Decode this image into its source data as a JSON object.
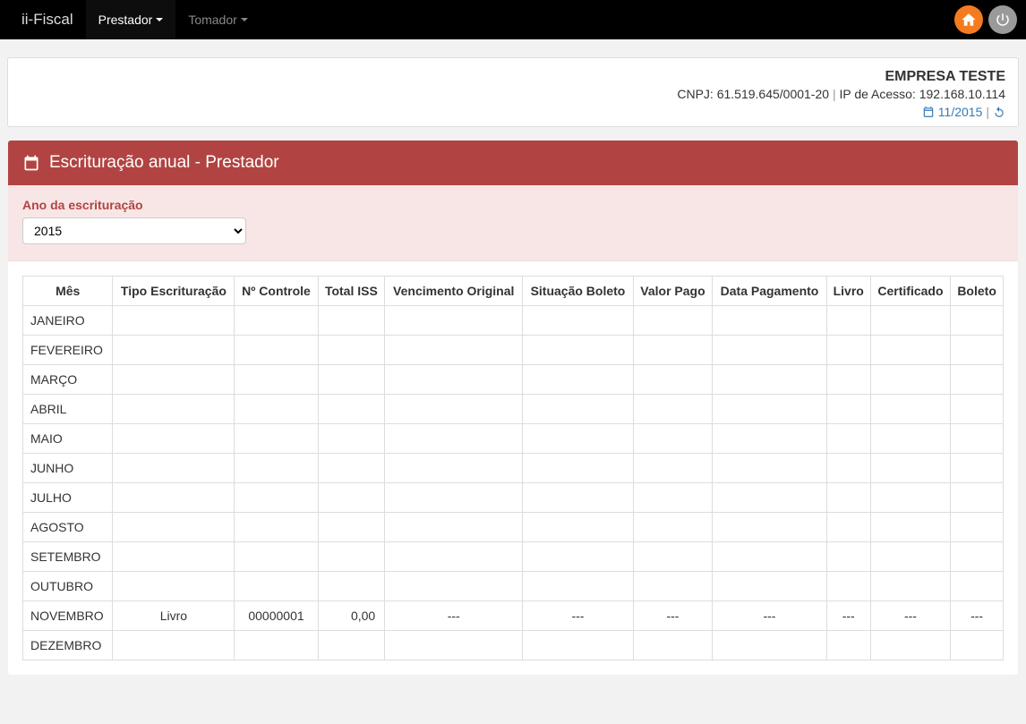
{
  "nav": {
    "brand": "ii-Fiscal",
    "items": [
      {
        "label": "Prestador",
        "active": true
      },
      {
        "label": "Tomador",
        "active": false
      }
    ]
  },
  "company": {
    "name": "EMPRESA TESTE",
    "cnpj_label": "CNPJ:",
    "cnpj": "61.519.645/0001-20",
    "ip_label": "IP de Acesso:",
    "ip": "192.168.10.114",
    "period": "11/2015"
  },
  "panel": {
    "title": "Escrituração anual - Prestador"
  },
  "filter": {
    "label": "Ano da escrituração",
    "year_value": "2015"
  },
  "table": {
    "headers": [
      "Mês",
      "Tipo Escrituração",
      "Nº Controle",
      "Total ISS",
      "Vencimento Original",
      "Situação Boleto",
      "Valor Pago",
      "Data Pagamento",
      "Livro",
      "Certificado",
      "Boleto"
    ],
    "rows": [
      {
        "mes": "JANEIRO",
        "tipo": "",
        "ctrl": "",
        "iss": "",
        "venc": "",
        "sit": "",
        "pago": "",
        "datap": "",
        "livro": "",
        "cert": "",
        "boleto": ""
      },
      {
        "mes": "FEVEREIRO",
        "tipo": "",
        "ctrl": "",
        "iss": "",
        "venc": "",
        "sit": "",
        "pago": "",
        "datap": "",
        "livro": "",
        "cert": "",
        "boleto": ""
      },
      {
        "mes": "MARÇO",
        "tipo": "",
        "ctrl": "",
        "iss": "",
        "venc": "",
        "sit": "",
        "pago": "",
        "datap": "",
        "livro": "",
        "cert": "",
        "boleto": ""
      },
      {
        "mes": "ABRIL",
        "tipo": "",
        "ctrl": "",
        "iss": "",
        "venc": "",
        "sit": "",
        "pago": "",
        "datap": "",
        "livro": "",
        "cert": "",
        "boleto": ""
      },
      {
        "mes": "MAIO",
        "tipo": "",
        "ctrl": "",
        "iss": "",
        "venc": "",
        "sit": "",
        "pago": "",
        "datap": "",
        "livro": "",
        "cert": "",
        "boleto": ""
      },
      {
        "mes": "JUNHO",
        "tipo": "",
        "ctrl": "",
        "iss": "",
        "venc": "",
        "sit": "",
        "pago": "",
        "datap": "",
        "livro": "",
        "cert": "",
        "boleto": ""
      },
      {
        "mes": "JULHO",
        "tipo": "",
        "ctrl": "",
        "iss": "",
        "venc": "",
        "sit": "",
        "pago": "",
        "datap": "",
        "livro": "",
        "cert": "",
        "boleto": ""
      },
      {
        "mes": "AGOSTO",
        "tipo": "",
        "ctrl": "",
        "iss": "",
        "venc": "",
        "sit": "",
        "pago": "",
        "datap": "",
        "livro": "",
        "cert": "",
        "boleto": ""
      },
      {
        "mes": "SETEMBRO",
        "tipo": "",
        "ctrl": "",
        "iss": "",
        "venc": "",
        "sit": "",
        "pago": "",
        "datap": "",
        "livro": "",
        "cert": "",
        "boleto": ""
      },
      {
        "mes": "OUTUBRO",
        "tipo": "",
        "ctrl": "",
        "iss": "",
        "venc": "",
        "sit": "",
        "pago": "",
        "datap": "",
        "livro": "",
        "cert": "",
        "boleto": ""
      },
      {
        "mes": "NOVEMBRO",
        "tipo": "Livro",
        "ctrl": "00000001",
        "iss": "0,00",
        "venc": "---",
        "sit": "---",
        "pago": "---",
        "datap": "---",
        "livro": "---",
        "cert": "---",
        "boleto": "---"
      },
      {
        "mes": "DEZEMBRO",
        "tipo": "",
        "ctrl": "",
        "iss": "",
        "venc": "",
        "sit": "",
        "pago": "",
        "datap": "",
        "livro": "",
        "cert": "",
        "boleto": ""
      }
    ]
  }
}
